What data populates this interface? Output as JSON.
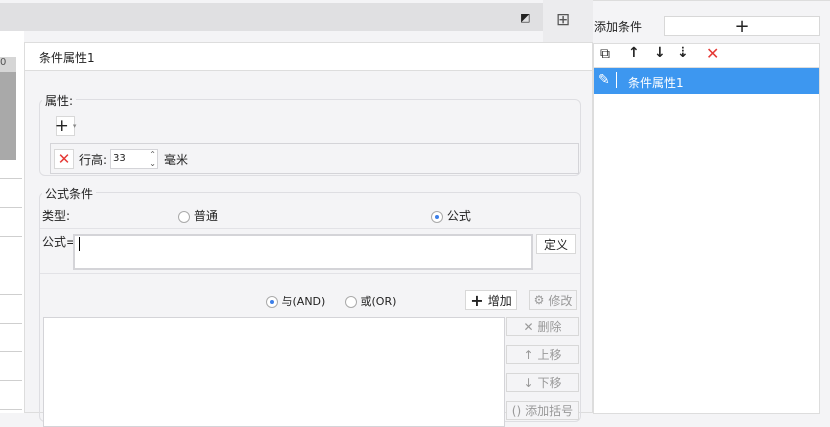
{
  "background": {
    "ruler_label": "0"
  },
  "right_panel": {
    "add_condition_label": "添加条件",
    "add_icon": "+",
    "list_items": [
      {
        "label": "条件属性1",
        "selected": true
      }
    ]
  },
  "dialog": {
    "title": "条件属性1",
    "attributes": {
      "legend": "属性:",
      "row_height_label": "行高:",
      "row_height_value": "33",
      "unit": "毫米"
    },
    "formula_condition": {
      "legend": "公式条件",
      "type_label": "类型:",
      "option_normal": "普通",
      "option_formula": "公式",
      "selected_type": "公式",
      "formula_label": "公式=",
      "formula_value": "",
      "define_button": "定义",
      "and_label": "与(AND)",
      "or_label": "或(OR)",
      "logic_selected": "AND",
      "add_button": "增加",
      "modify_button": "修改",
      "delete_button": "删除",
      "move_up_button": "上移",
      "move_down_button": "下移",
      "add_bracket_button": "添加括号"
    }
  },
  "colors": {
    "selected": "#3d97f0",
    "delete_red": "#e53935"
  }
}
